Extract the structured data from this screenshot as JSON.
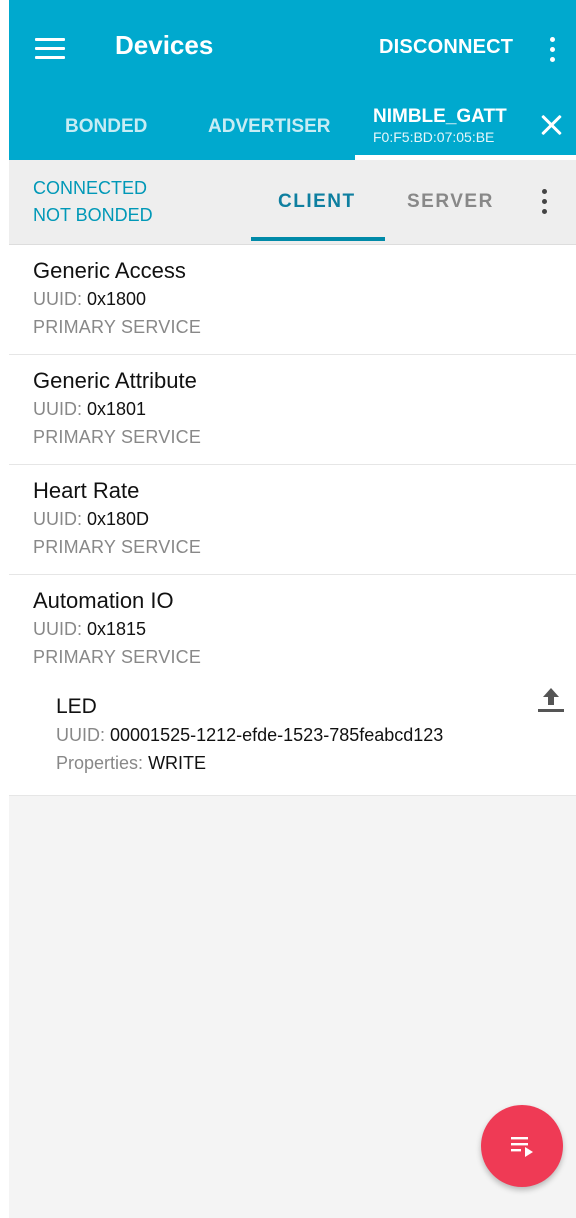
{
  "toolbar": {
    "title": "Devices",
    "disconnect_label": "DISCONNECT"
  },
  "device_tabs": {
    "bonded": "BONDED",
    "advertiser": "ADVERTISER",
    "active": {
      "name": "NIMBLE_GATT",
      "address": "F0:F5:BD:07:05:BE"
    }
  },
  "connection": {
    "status": "CONNECTED",
    "bond_status": "NOT BONDED",
    "tabs": {
      "client": "CLIENT",
      "server": "SERVER"
    }
  },
  "services": [
    {
      "name": "Generic Access",
      "uuid_label": "UUID:",
      "uuid": "0x1800",
      "type": "PRIMARY SERVICE"
    },
    {
      "name": "Generic Attribute",
      "uuid_label": "UUID:",
      "uuid": "0x1801",
      "type": "PRIMARY SERVICE"
    },
    {
      "name": "Heart Rate",
      "uuid_label": "UUID:",
      "uuid": "0x180D",
      "type": "PRIMARY SERVICE"
    },
    {
      "name": "Automation IO",
      "uuid_label": "UUID:",
      "uuid": "0x1815",
      "type": "PRIMARY SERVICE"
    }
  ],
  "characteristic": {
    "name": "LED",
    "uuid_label": "UUID:",
    "uuid": "00001525-1212-efde-1523-785feabcd123",
    "properties_label": "Properties:",
    "properties": "WRITE"
  },
  "colors": {
    "primary": "#00a9ce",
    "accent": "#ef3a55",
    "tab_active": "#0e7fa0"
  },
  "icons": {
    "menu": "menu-icon",
    "more": "more-vert-icon",
    "close": "close-icon",
    "write": "upload-icon",
    "log": "playlist-play-icon"
  }
}
